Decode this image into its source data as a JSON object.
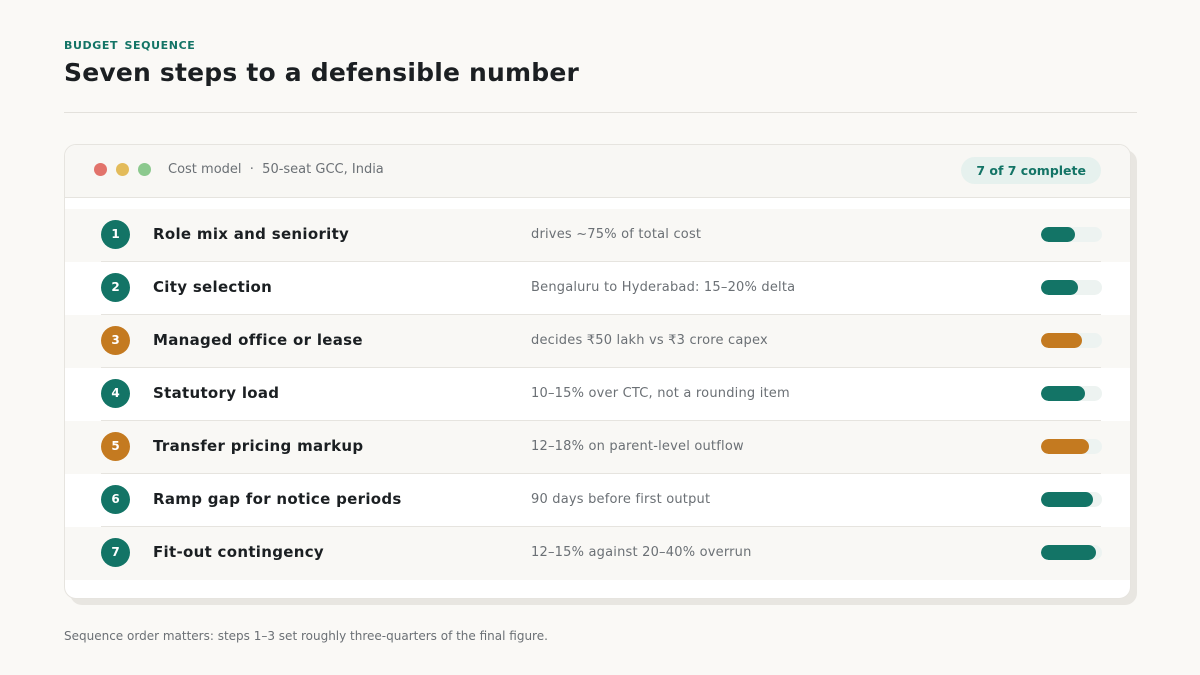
{
  "header": {
    "eyebrow": "BUDGET SEQUENCE",
    "title": "Seven steps to a defensible number"
  },
  "window": {
    "title": "Cost model  ·  50-seat GCC, India",
    "badge": "7 of 7 complete"
  },
  "colors": {
    "teal": "#137466",
    "amber": "#c47a20",
    "track": "#edf3f1"
  },
  "steps": [
    {
      "num": "1",
      "title": "Role mix and seniority",
      "note": "drives ~75% of total cost",
      "color": "teal",
      "progress": 0.56
    },
    {
      "num": "2",
      "title": "City selection",
      "note": "Bengaluru to Hyderabad: 15–20% delta",
      "color": "teal",
      "progress": 0.61
    },
    {
      "num": "3",
      "title": "Managed office or lease",
      "note": "decides ₹50 lakh vs ₹3 crore capex",
      "color": "amber",
      "progress": 0.67
    },
    {
      "num": "4",
      "title": "Statutory load",
      "note": "10–15% over CTC, not a rounding item",
      "color": "teal",
      "progress": 0.72
    },
    {
      "num": "5",
      "title": "Transfer pricing markup",
      "note": "12–18% on parent-level outflow",
      "color": "amber",
      "progress": 0.79
    },
    {
      "num": "6",
      "title": "Ramp gap for notice periods",
      "note": "90 days before first output",
      "color": "teal",
      "progress": 0.85
    },
    {
      "num": "7",
      "title": "Fit-out contingency",
      "note": "12–15% against 20–40% overrun",
      "color": "teal",
      "progress": 0.9
    }
  ],
  "footnote": "Sequence order matters: steps 1–3 set roughly three-quarters of the final figure."
}
